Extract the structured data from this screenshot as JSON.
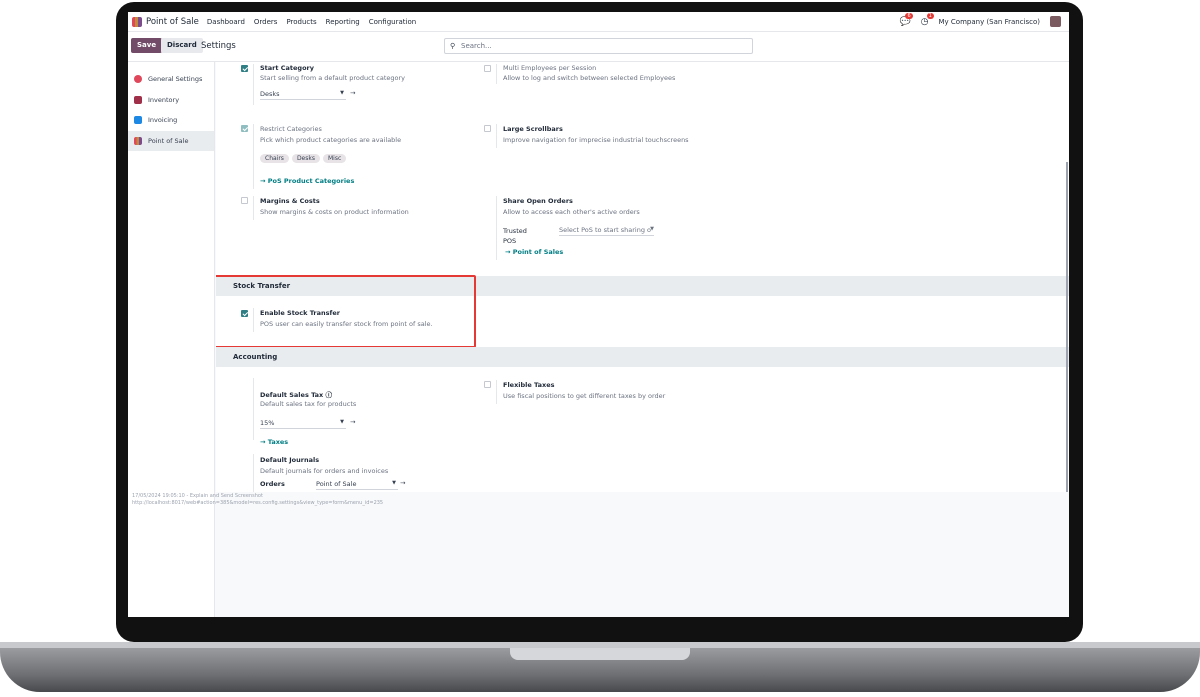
{
  "navbar": {
    "app": "Point of Sale",
    "menu": [
      "Dashboard",
      "Orders",
      "Products",
      "Reporting",
      "Configuration"
    ],
    "messages_count": "6",
    "activities_count": "1",
    "company": "My Company (San Francisco)"
  },
  "control": {
    "save": "Save",
    "discard": "Discard",
    "title": "Settings",
    "search_placeholder": "Search..."
  },
  "sidebar": {
    "items": [
      {
        "label": "General Settings",
        "color": "#e0475b"
      },
      {
        "label": "Inventory",
        "color": "#a0304a"
      },
      {
        "label": "Invoicing",
        "color": "#1e88e5"
      },
      {
        "label": "Point of Sale",
        "color": "#c38b3c"
      }
    ]
  },
  "settings": {
    "start_category": {
      "title": "Start Category",
      "desc": "Start selling from a default product category",
      "value": "Desks",
      "checked": true
    },
    "multi_employees": {
      "title": "Multi Employees per Session",
      "desc": "Allow to log and switch between selected Employees",
      "checked": false
    },
    "restrict_categories": {
      "title": "Restrict Categories",
      "desc": "Pick which product categories are available",
      "tags": [
        "Chairs",
        "Desks",
        "Misc"
      ],
      "link": "PoS Product Categories",
      "checked": true
    },
    "large_scrollbars": {
      "title": "Large Scrollbars",
      "desc": "Improve navigation for imprecise industrial touchscreens",
      "checked": false
    },
    "margins": {
      "title": "Margins & Costs",
      "desc": "Show margins & costs on product information",
      "checked": false
    },
    "share_orders": {
      "title": "Share Open Orders",
      "desc": "Allow to access each other's active orders",
      "label": "Trusted POS",
      "placeholder": "Select PoS to start sharing o",
      "link": "Point of Sales"
    }
  },
  "stock_transfer": {
    "section": "Stock Transfer",
    "title": "Enable Stock Transfer",
    "desc": "POS user can easily transfer stock from point of sale.",
    "checked": true
  },
  "accounting": {
    "section": "Accounting",
    "sales_tax": {
      "title": "Default Sales Tax",
      "desc": "Default sales tax for products",
      "value": "15%",
      "link": "Taxes"
    },
    "flexible_taxes": {
      "title": "Flexible Taxes",
      "desc": "Use fiscal positions to get different taxes by order",
      "checked": false
    },
    "journals": {
      "title": "Default Journals",
      "desc": "Default journals for orders and invoices",
      "orders_label": "Orders",
      "orders_value": "Point of Sale"
    }
  },
  "footer": {
    "line1": "17/05/2024 19:05:10 - Explain and Send Screenshot",
    "line2": "http://localhost:8017/web#action=385&model=res.config.settings&view_type=form&menu_id=235"
  }
}
